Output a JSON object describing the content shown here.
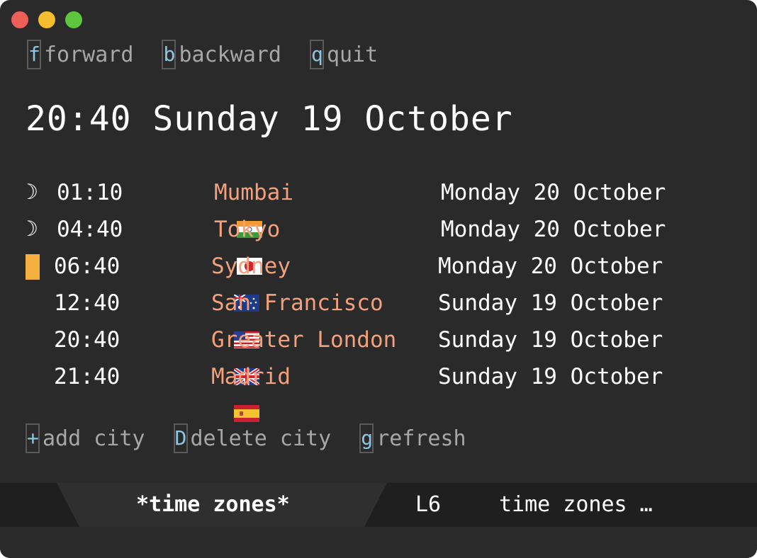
{
  "window": {
    "controls": [
      "close",
      "minimize",
      "maximize"
    ],
    "colors": {
      "background": "#2a2a2a",
      "accent_city": "#f3a07c",
      "key": "#8ec7e6",
      "marker": "#f4b03e"
    }
  },
  "nav_keys": [
    {
      "key": "f",
      "label": "forward"
    },
    {
      "key": "b",
      "label": "backward"
    },
    {
      "key": "q",
      "label": "quit"
    }
  ],
  "current": {
    "heading": "20:40 Sunday 19 October"
  },
  "cities": [
    {
      "indicator": "moon",
      "indicator_glyph": "☽",
      "time": "01:10",
      "flag": "india-flag",
      "city": "Mumbai",
      "date": "Monday 20 October"
    },
    {
      "indicator": "moon",
      "indicator_glyph": "☽",
      "time": "04:40",
      "flag": "japan-flag",
      "city": "Tokyo",
      "date": "Monday 20 October"
    },
    {
      "indicator": "cursor-bar",
      "indicator_glyph": "",
      "time": "06:40",
      "flag": "australia-flag",
      "city": "Sydney",
      "date": "Monday 20 October"
    },
    {
      "indicator": "none",
      "indicator_glyph": "",
      "time": "12:40",
      "flag": "usa-flag",
      "city": "San Francisco",
      "date": "Sunday 19 October"
    },
    {
      "indicator": "none",
      "indicator_glyph": "",
      "time": "20:40",
      "flag": "uk-flag",
      "city": "Greater London",
      "date": "Sunday 19 October"
    },
    {
      "indicator": "none",
      "indicator_glyph": "",
      "time": "21:40",
      "flag": "spain-flag",
      "city": "Madrid",
      "date": "Sunday 19 October"
    }
  ],
  "action_keys": [
    {
      "key": "+",
      "label": "add city"
    },
    {
      "key": "D",
      "label": "delete city"
    },
    {
      "key": "g",
      "label": "refresh"
    }
  ],
  "status_bar": {
    "buffer_name": "*time zones*",
    "line": "L6",
    "mode": "time zones …"
  }
}
